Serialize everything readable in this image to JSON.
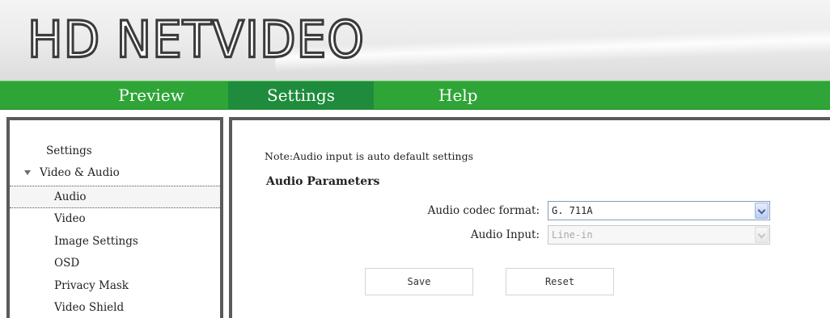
{
  "header": {
    "logo_text": "HD NETVIDEO"
  },
  "nav": {
    "preview": "Preview",
    "settings": "Settings",
    "help": "Help"
  },
  "sidebar": {
    "root": "Settings",
    "group": "Video & Audio",
    "items": [
      "Audio",
      "Video",
      "Image Settings",
      "OSD",
      "Privacy Mask",
      "Video Shield"
    ],
    "selected_index": 0
  },
  "main": {
    "note": "Note:Audio input is auto default settings",
    "section_title": "Audio Parameters",
    "codec_label": "Audio codec format:",
    "codec_value": "G. 711A",
    "input_label": "Audio Input:",
    "input_value": "Line-in",
    "save_label": "Save",
    "reset_label": "Reset"
  },
  "colors": {
    "nav_green": "#2fa537",
    "nav_active": "#1e8c3c",
    "frame_border": "#5a5a5a"
  }
}
